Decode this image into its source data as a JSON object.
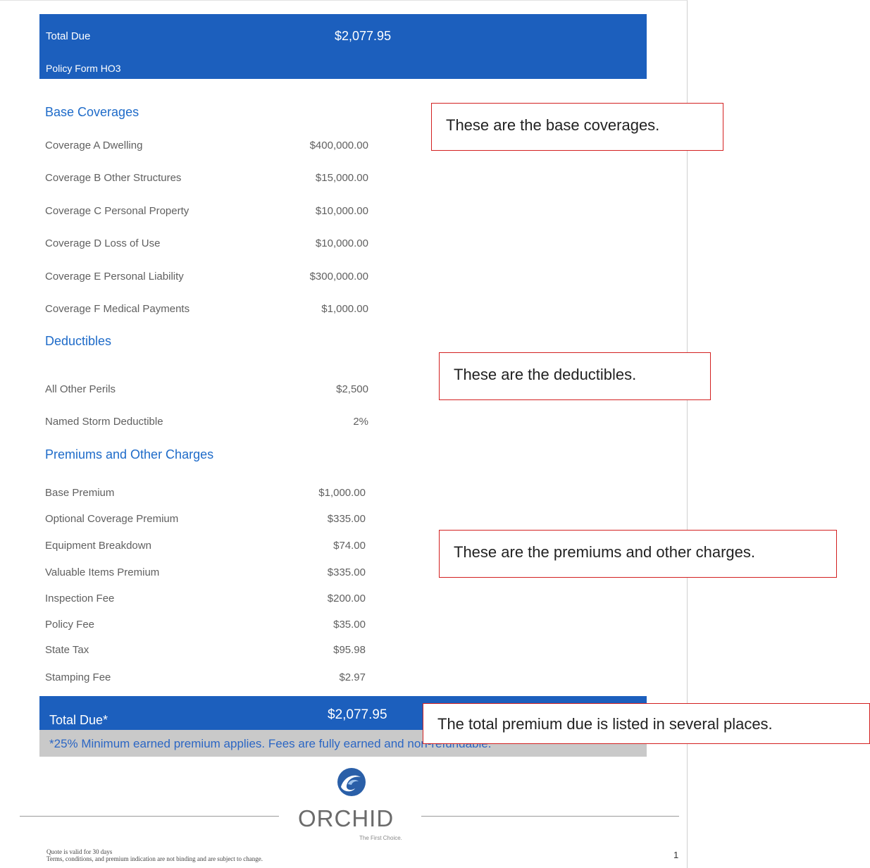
{
  "header_banner": {
    "total_due_label": "Total Due",
    "total_due_value": "$2,077.95",
    "policy_form": "Policy Form HO3"
  },
  "base_coverages": {
    "title": "Base Coverages",
    "rows": [
      {
        "label": "Coverage A Dwelling",
        "value": "$400,000.00"
      },
      {
        "label": "Coverage B Other Structures",
        "value": "$15,000.00"
      },
      {
        "label": "Coverage C Personal Property",
        "value": "$10,000.00"
      },
      {
        "label": "Coverage D Loss of Use",
        "value": "$10,000.00"
      },
      {
        "label": "Coverage E Personal Liability",
        "value": "$300,000.00"
      },
      {
        "label": "Coverage F Medical Payments",
        "value": "$1,000.00"
      }
    ]
  },
  "deductibles": {
    "title": "Deductibles",
    "rows": [
      {
        "label": "All Other Perils",
        "value": "$2,500"
      },
      {
        "label": "Named Storm Deductible",
        "value": "2%"
      }
    ]
  },
  "premiums": {
    "title": "Premiums and Other Charges",
    "rows": [
      {
        "label": "Base Premium",
        "value": "$1,000.00"
      },
      {
        "label": "Optional Coverage Premium",
        "value": "$335.00"
      },
      {
        "label": "Equipment Breakdown",
        "value": "$74.00"
      },
      {
        "label": "Valuable Items Premium",
        "value": "$335.00"
      },
      {
        "label": "Inspection Fee",
        "value": "$200.00"
      },
      {
        "label": "Policy Fee",
        "value": "$35.00"
      },
      {
        "label": "State Tax",
        "value": "$95.98"
      },
      {
        "label": "Stamping Fee",
        "value": "$2.97"
      }
    ]
  },
  "footer_banner": {
    "total_due_label": "Total Due*",
    "total_due_value": "$2,077.95",
    "note": "*25% Minimum earned premium applies. Fees are fully earned and non-refundable."
  },
  "callouts": {
    "base": "These are the base coverages.",
    "deductibles": "These are the deductibles.",
    "premiums": "These are the premiums and other charges.",
    "total": "The total premium due is listed in several places."
  },
  "brand": {
    "name": "ORCHID",
    "tagline": "The First Choice.",
    "icon": "wave-logo-icon"
  },
  "footer": {
    "line1": "Quote is valid for 30 days",
    "line2": "Terms, conditions, and premium indication are not binding and are subject to change.",
    "page_number": "1"
  }
}
